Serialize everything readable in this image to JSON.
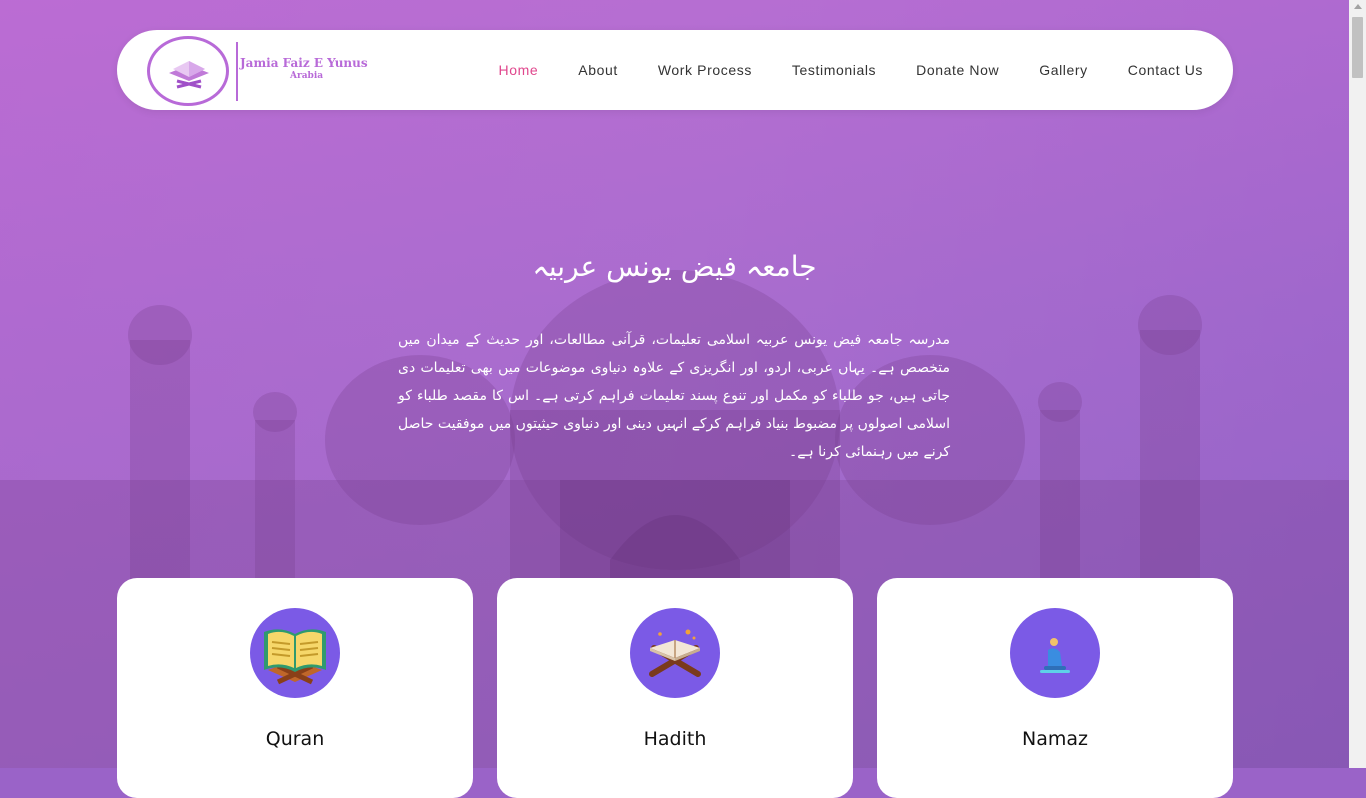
{
  "brand": {
    "title": "Jamia Faiz E Yunus",
    "subtitle": "Arabia"
  },
  "nav": {
    "items": [
      {
        "label": "Home",
        "active": true
      },
      {
        "label": "About",
        "active": false
      },
      {
        "label": "Work Process",
        "active": false
      },
      {
        "label": "Testimonials",
        "active": false
      },
      {
        "label": "Donate Now",
        "active": false
      },
      {
        "label": "Gallery",
        "active": false
      },
      {
        "label": "Contact Us",
        "active": false
      }
    ]
  },
  "hero": {
    "title": "جامعہ فیض یونس عربیہ",
    "text": "مدرسہ جامعہ فیض یونس عربیہ اسلامی تعلیمات، قرآنی مطالعات، اور حدیث کے میدان میں متخصص ہے۔ یہاں عربی، اردو، اور انگریزی کے علاوہ دنیاوی موضوعات میں بھی تعلیمات دی جاتی ہیں، جو طلباء کو مکمل اور تنوع پسند تعلیمات فراہم کرتی ہے۔ اس کا مقصد طلباء کو اسلامی اصولوں پر مضبوط بنیاد فراہم کرکے انہیں دینی اور دنیاوی حیثیتوں میں موفقیت حاصل کرنے میں رہنمائی کرنا ہے۔"
  },
  "cards": [
    {
      "label": "Quran",
      "icon": "quran-book-icon"
    },
    {
      "label": "Hadith",
      "icon": "hadith-book-icon"
    },
    {
      "label": "Namaz",
      "icon": "prayer-icon"
    }
  ],
  "colors": {
    "accent": "#e0478d",
    "brand": "#b86ad8",
    "icon_bg": "#7b5ae6"
  }
}
